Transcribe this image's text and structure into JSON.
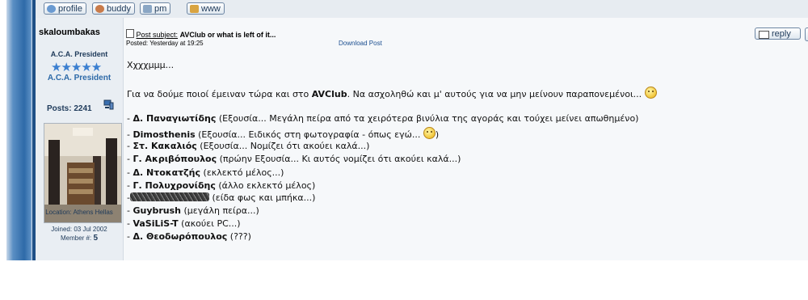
{
  "toolbar": {
    "profile_label": "profile",
    "buddy_label": "buddy",
    "pm_label": "pm",
    "www_label": "www"
  },
  "author": {
    "username": "skaloumbakas",
    "rank_title": "A.C.A. President",
    "stars": "★★★★★",
    "rank_label": "A.C.A. President",
    "posts": "Posts: 2241",
    "location": "Location: Athens Hellas",
    "joined": "Joined: 03 Jul 2002",
    "member_no_label": "Member #:",
    "member_no": "5"
  },
  "post": {
    "subject_label": "Post subject:",
    "subject": "AVClub or what is left of it...",
    "posted": "Posted: Yesterday at 19:25",
    "download": "Download Post",
    "reply_label": "reply",
    "greeting": "Χχχχμμμ...",
    "intro_pre": "Για να δούμε ποιοί έμειναν τώρα και στο ",
    "intro_bold": "AVClub",
    "intro_post": ". Να ασχοληθώ και μ' αυτούς για να μην μείνουν παραπονεμένοι...",
    "lines": [
      {
        "prefix": "- ",
        "name": "Δ. Παναγιωτίδης",
        "desc": " (Εξουσία... Μεγάλη πείρα από τα χειρότερα βινύλια της αγοράς και τούχει μείνει απωθημένο)"
      },
      {
        "prefix": "- ",
        "name": "Dimosthenis",
        "desc": " (Εξουσία... Ειδικός στη φωτογραφία - όπως εγώ...",
        "desc_tail": ")"
      },
      {
        "prefix": "- ",
        "name": "Στ. Κακαλιός",
        "desc": " (Εξουσία... Νομίζει ότι ακούει καλά...)"
      },
      {
        "prefix": "- ",
        "name": "Γ. Ακριβόπουλος",
        "desc": " (πρώην Εξουσία... Κι αυτός νομίζει ότι ακούει καλά...)"
      },
      {
        "prefix": "- ",
        "name": "Δ. Ντοκατζής",
        "desc": " (εκλεκτό μέλος...)"
      },
      {
        "prefix": "- ",
        "name": "Γ. Πολυχρονίδης",
        "desc": " (άλλο εκλεκτό μέλος)"
      },
      {
        "prefix": "-",
        "name": "",
        "desc": " (είδα φως και μπήκα...)"
      },
      {
        "prefix": "- ",
        "name": "Guybrush",
        "desc": " (μεγάλη πείρα...)"
      },
      {
        "prefix": "- ",
        "name": "VaSiLiS-T",
        "desc": " (ακούει PC...)"
      },
      {
        "prefix": "- ",
        "name": "Δ. Θεοδωρόπουλος",
        "desc": " (???)"
      }
    ]
  },
  "icons": {
    "profile": "profile-icon",
    "buddy": "buddy-icon",
    "pm": "pm-icon",
    "www": "www-icon",
    "post": "post-icon",
    "reply": "reply-icon",
    "smiley": "smiley-icon",
    "pc": "pc-icon"
  },
  "colors": {
    "accent_blue": "#2e6aa8",
    "rank_blue": "#3b7fd0",
    "link": "#1a4d8f"
  }
}
